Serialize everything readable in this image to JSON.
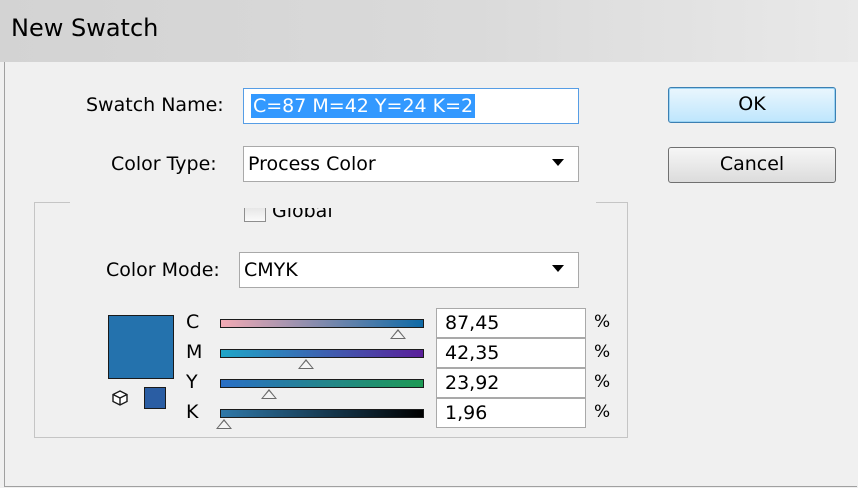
{
  "window": {
    "title": "New Swatch"
  },
  "swatch_name": {
    "label": "Swatch Name:",
    "value": "C=87 M=42 Y=24 K=2"
  },
  "color_type": {
    "label": "Color Type:",
    "value": "Process Color"
  },
  "global": {
    "label": "Global",
    "checked": false
  },
  "color_mode": {
    "label": "Color Mode:",
    "value": "CMYK"
  },
  "buttons": {
    "ok": "OK",
    "cancel": "Cancel"
  },
  "swatch_color": "#2472ad",
  "small_swatch_color": "#2a5da3",
  "channels": [
    {
      "letter": "C",
      "value": "87,45",
      "unit": "%",
      "level": 0.8745,
      "gradient": [
        "#f2aab4",
        "#0f6aa6"
      ]
    },
    {
      "letter": "M",
      "value": "42,35",
      "unit": "%",
      "level": 0.4235,
      "gradient": [
        "#1fa6c8",
        "#5a1f9a"
      ]
    },
    {
      "letter": "Y",
      "value": "23,92",
      "unit": "%",
      "level": 0.2392,
      "gradient": [
        "#2a6fc6",
        "#1e9a55"
      ]
    },
    {
      "letter": "K",
      "value": "1,96",
      "unit": "%",
      "level": 0.0196,
      "gradient": [
        "#2f78a8",
        "#000000"
      ]
    }
  ]
}
